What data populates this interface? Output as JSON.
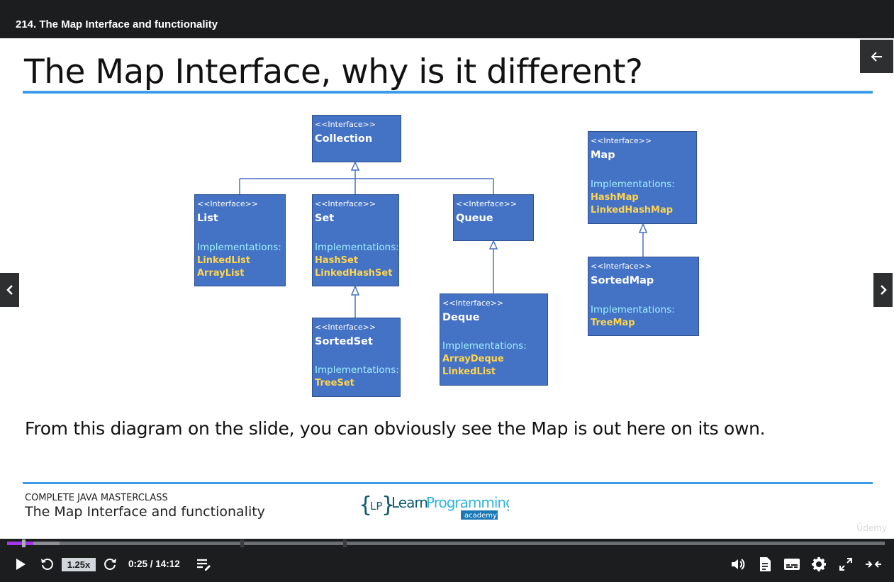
{
  "window": {
    "lecture_title": "214. The Map Interface and functionality"
  },
  "slide": {
    "title": "The Map Interface, why is it different?",
    "caption": "From this diagram on the slide, you can obviously see the Map is out here on its own.",
    "footer_course": "COMPLETE JAVA MASTERCLASS",
    "footer_lecture": "The Map Interface and functionality",
    "logo": {
      "brace_open": "{",
      "initials": "LP",
      "brace_close": "}",
      "learn": "Learn",
      "programming": "Programming",
      "academy": "academy"
    },
    "watermark": "Ūdemy"
  },
  "diagram": {
    "stereotype": "<<Interface>>",
    "impl_label": "Implementations:",
    "colors": {
      "box": "#4472c4",
      "impl": "#9ef0ff",
      "item": "#ffd54f",
      "line": "#4472c4"
    },
    "collection": {
      "name": "Collection"
    },
    "list": {
      "name": "List",
      "items": [
        "LinkedList",
        "ArrayList"
      ]
    },
    "set": {
      "name": "Set",
      "items": [
        "HashSet",
        "LinkedHashSet"
      ]
    },
    "queue": {
      "name": "Queue"
    },
    "sortedset": {
      "name": "SortedSet",
      "items": [
        "TreeSet"
      ]
    },
    "deque": {
      "name": "Deque",
      "items": [
        "ArrayDeque",
        "LinkedList"
      ]
    },
    "map": {
      "name": "Map",
      "items": [
        "HashMap",
        "LinkedHashMap"
      ]
    },
    "sortedmap": {
      "name": "SortedMap",
      "items": [
        "TreeMap"
      ]
    }
  },
  "player": {
    "speed": "1.25x",
    "time": "0:25 / 14:12",
    "progress_played_pct": 3,
    "progress_loaded_pct": 6,
    "accent": "#a435f0",
    "icons": [
      "play-icon",
      "rewind-icon",
      "forward-icon",
      "notes-icon",
      "volume-icon",
      "transcript-icon",
      "captions-icon",
      "settings-icon",
      "fullscreen-icon",
      "expand-icon"
    ]
  }
}
